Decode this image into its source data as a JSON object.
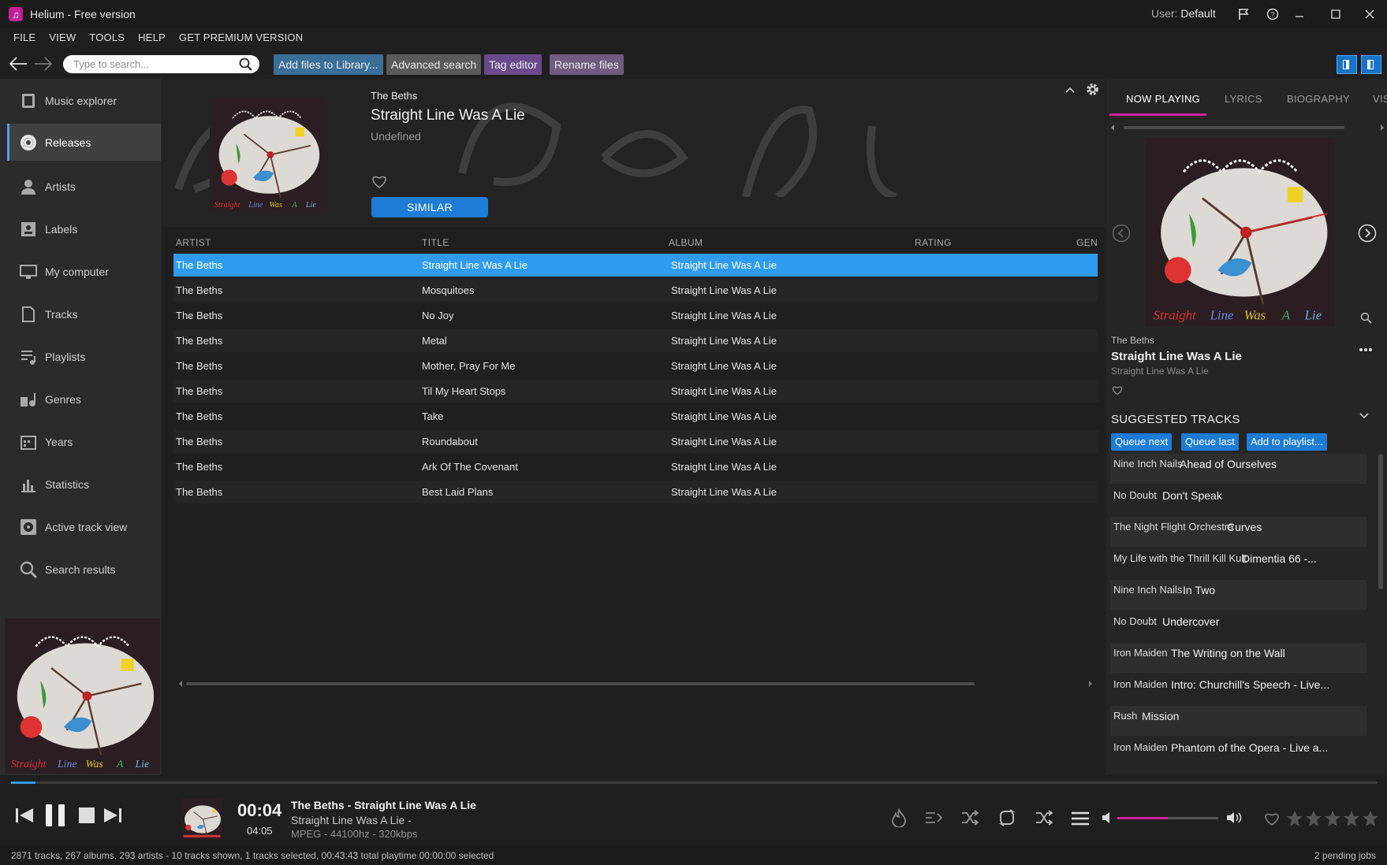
{
  "window": {
    "title": "Helium - Free version",
    "user_label": "User:",
    "user_name": "Default"
  },
  "menu": [
    "FILE",
    "VIEW",
    "TOOLS",
    "HELP",
    "GET PREMIUM VERSION"
  ],
  "toolbar": {
    "search_placeholder": "Type to search...",
    "add_files": "Add files to Library...",
    "advanced_search": "Advanced search",
    "tag_editor": "Tag editor",
    "rename_files": "Rename files"
  },
  "sidebar": {
    "items": [
      {
        "label": "Music explorer",
        "icon": "music-explorer-icon"
      },
      {
        "label": "Releases",
        "icon": "disc-icon",
        "active": true
      },
      {
        "label": "Artists",
        "icon": "person-icon"
      },
      {
        "label": "Labels",
        "icon": "label-icon"
      },
      {
        "label": "My computer",
        "icon": "monitor-icon"
      },
      {
        "label": "Tracks",
        "icon": "tracks-icon"
      },
      {
        "label": "Playlists",
        "icon": "playlist-icon"
      },
      {
        "label": "Genres",
        "icon": "genres-icon"
      },
      {
        "label": "Years",
        "icon": "calendar-icon"
      },
      {
        "label": "Statistics",
        "icon": "statistics-icon"
      },
      {
        "label": "Active track view",
        "icon": "active-track-icon"
      },
      {
        "label": "Search results",
        "icon": "search-icon"
      }
    ]
  },
  "release": {
    "artist": "The Beths",
    "title": "Straight Line Was A Lie",
    "genre": "Undefined",
    "similar_label": "SIMILAR"
  },
  "table": {
    "headers": [
      "ARTIST",
      "TITLE",
      "ALBUM",
      "RATING",
      "GEN"
    ],
    "rows": [
      {
        "artist": "The Beths",
        "title": "Straight Line Was A Lie",
        "album": "Straight Line Was A Lie"
      },
      {
        "artist": "The Beths",
        "title": "Mosquitoes",
        "album": "Straight Line Was A Lie"
      },
      {
        "artist": "The Beths",
        "title": "No Joy",
        "album": "Straight Line Was A Lie"
      },
      {
        "artist": "The Beths",
        "title": "Metal",
        "album": "Straight Line Was A Lie"
      },
      {
        "artist": "The Beths",
        "title": "Mother, Pray For Me",
        "album": "Straight Line Was A Lie"
      },
      {
        "artist": "The Beths",
        "title": "Til My Heart Stops",
        "album": "Straight Line Was A Lie"
      },
      {
        "artist": "The Beths",
        "title": "Take",
        "album": "Straight Line Was A Lie"
      },
      {
        "artist": "The Beths",
        "title": "Roundabout",
        "album": "Straight Line Was A Lie"
      },
      {
        "artist": "The Beths",
        "title": "Ark Of The Covenant",
        "album": "Straight Line Was A Lie"
      },
      {
        "artist": "The Beths",
        "title": "Best Laid Plans",
        "album": "Straight Line Was A Lie"
      }
    ]
  },
  "right_panel": {
    "tabs": [
      "NOW PLAYING",
      "LYRICS",
      "BIOGRAPHY",
      "VIS"
    ],
    "now_playing": {
      "artist": "The Beths",
      "title": "Straight Line Was A Lie",
      "album": "Straight Line Was A Lie"
    },
    "suggested": {
      "heading": "SUGGESTED TRACKS",
      "queue_next": "Queue next",
      "queue_last": "Queue last",
      "add_to_playlist": "Add to playlist...",
      "tracks": [
        {
          "artist": "Nine Inch Nails",
          "title": "Ahead of Ourselves"
        },
        {
          "artist": "No Doubt",
          "title": "Don't Speak"
        },
        {
          "artist": "The Night Flight Orchestra",
          "title": "Curves"
        },
        {
          "artist": "My Life with the Thrill Kill Kult",
          "title": "Dimentia 66 -..."
        },
        {
          "artist": "Nine Inch Nails",
          "title": "In Two"
        },
        {
          "artist": "No Doubt",
          "title": "Undercover"
        },
        {
          "artist": "Iron Maiden",
          "title": "The Writing on the Wall"
        },
        {
          "artist": "Iron Maiden",
          "title": "Intro: Churchill's Speech - Live..."
        },
        {
          "artist": "Rush",
          "title": "Mission"
        },
        {
          "artist": "Iron Maiden",
          "title": "Phantom of the Opera - Live a..."
        }
      ]
    }
  },
  "player": {
    "time": "00:04",
    "duration": "04:05",
    "track": "The Beths - Straight Line Was A Lie",
    "album_line": "Straight Line Was A Lie -",
    "format": "MPEG - 44100hz - 320kbps",
    "progress": 0.018,
    "volume": 0.5,
    "rating": 0
  },
  "status": {
    "left": "2871 tracks, 267 albums, 293 artists - 10 tracks shown, 1 tracks selected, 00:43:43 total playtime 00:00:00 selected",
    "right": "2 pending jobs"
  },
  "colors": {
    "accent": "#2f9bf0",
    "highlight": "#d11fa1",
    "button": "#1d7cd6"
  }
}
